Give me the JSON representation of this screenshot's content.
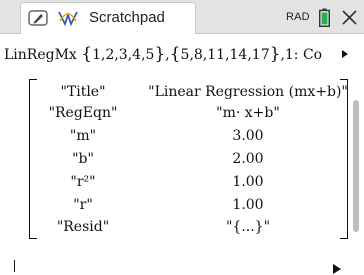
{
  "tab": {
    "doc_icon": "document-pencil-icon",
    "app_icon": "calculator-graph-icon",
    "title": "Scratchpad"
  },
  "status": {
    "angle_mode": "RAD",
    "battery_icon": "battery-icon",
    "close_icon": "close-x-icon"
  },
  "command": {
    "name": "LinRegMx",
    "list1": "1,2,3,4,5",
    "list2": "5,8,11,14,17",
    "rest": ",1: Co"
  },
  "result": {
    "rows": [
      {
        "key": "\"Title\"",
        "value": "\"Linear Regression (mx+b)\""
      },
      {
        "key": "\"RegEqn\"",
        "value": "\"m· x+b\""
      },
      {
        "key": "\"m\"",
        "value": "3.00"
      },
      {
        "key": "\"b\"",
        "value": "2.00"
      },
      {
        "key": "\"r²\"",
        "value": "1.00"
      },
      {
        "key": "\"r\"",
        "value": "1.00"
      },
      {
        "key": "\"Resid\"",
        "value": "\"{...}\""
      }
    ]
  },
  "colors": {
    "titlebar": "#e3e3e3",
    "battery_fill": "#22b14c",
    "text": "#111111"
  }
}
